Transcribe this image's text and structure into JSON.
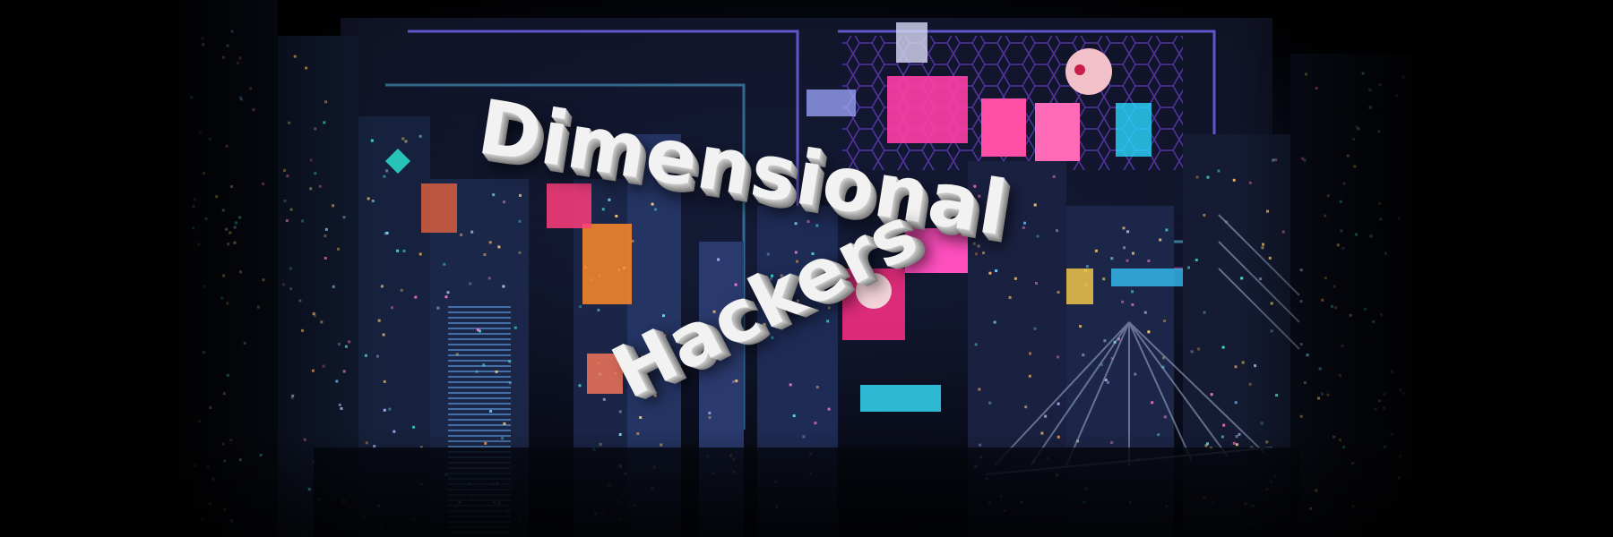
{
  "banner": {
    "title_line_1": "Dimensional",
    "title_line_2": "Hackers"
  },
  "colors": {
    "background": "#000000",
    "title_text": "#f2f2f2",
    "neon_pink": "#ff3fa8",
    "neon_cyan": "#27e6ff",
    "neon_blue": "#4a6cff",
    "neon_orange": "#ff8a2a",
    "neon_purple": "#9b4dff"
  },
  "scene": {
    "subject": "neon cyberpunk city",
    "signs": [
      "pink billboard",
      "cyan billboard",
      "orange signs",
      "hexagon wall"
    ]
  }
}
